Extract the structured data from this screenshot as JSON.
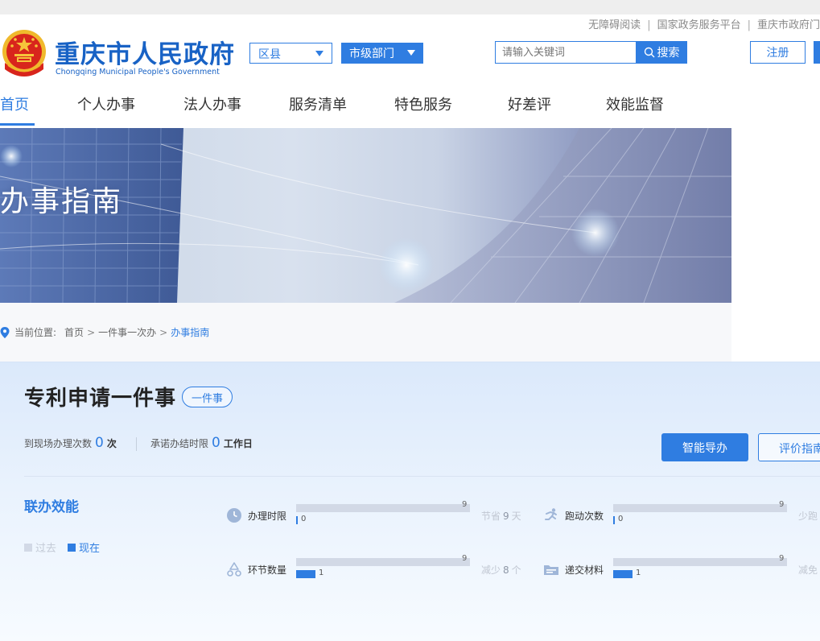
{
  "top_links": [
    "无障碍阅读",
    "国家政务服务平台",
    "重庆市政府门"
  ],
  "site": {
    "name": "重庆市人民政府",
    "name_en": "Chongqing Municipal People's Government"
  },
  "header": {
    "county_select": "区县",
    "dept_select": "市级部门",
    "search_placeholder": "请输入关键词",
    "search_button": "搜索",
    "register_button": "注册"
  },
  "nav": {
    "items": [
      "首页",
      "个人办事",
      "法人办事",
      "服务清单",
      "特色服务",
      "好差评",
      "效能监督"
    ],
    "active_index": 0
  },
  "banner": {
    "title": "办事指南"
  },
  "breadcrumb": {
    "label": "当前位置:",
    "items": [
      "首页",
      "一件事一次办"
    ],
    "current": "办事指南"
  },
  "service": {
    "title": "专利申请一件事",
    "tag": "一件事",
    "visits_label": "到现场办理次数",
    "visits_value": "0",
    "visits_unit": "次",
    "deadline_label": "承诺办结时限",
    "deadline_value": "0",
    "deadline_unit": "工作日",
    "guide_button": "智能导办",
    "eval_button": "评价指南"
  },
  "efficiency": {
    "title": "联办效能",
    "legend_past": "过去",
    "legend_now": "现在",
    "metrics": [
      {
        "icon": "clock-icon",
        "label": "办理时限",
        "past": 9,
        "now": 0,
        "past_text": "9",
        "now_text": "0",
        "saved_prefix": "节省",
        "saved_value": "9",
        "saved_unit": "天"
      },
      {
        "icon": "runner-icon",
        "label": "跑动次数",
        "past": 9,
        "now": 0,
        "past_text": "9",
        "now_text": "0",
        "saved_prefix": "少跑",
        "saved_value": "",
        "saved_unit": ""
      },
      {
        "icon": "cycle-icon",
        "label": "环节数量",
        "past": 9,
        "now": 1,
        "past_text": "9",
        "now_text": "1",
        "saved_prefix": "减少",
        "saved_value": "8",
        "saved_unit": "个"
      },
      {
        "icon": "folder-icon",
        "label": "递交材料",
        "past": 9,
        "now": 1,
        "past_text": "9",
        "now_text": "1",
        "saved_prefix": "减免",
        "saved_value": "",
        "saved_unit": ""
      }
    ]
  },
  "colors": {
    "primary": "#2f7de1",
    "brand_text": "#1862c5",
    "past_bar": "#d2d9e6",
    "emblem_red": "#d8251c",
    "emblem_gold": "#f0b92c"
  }
}
